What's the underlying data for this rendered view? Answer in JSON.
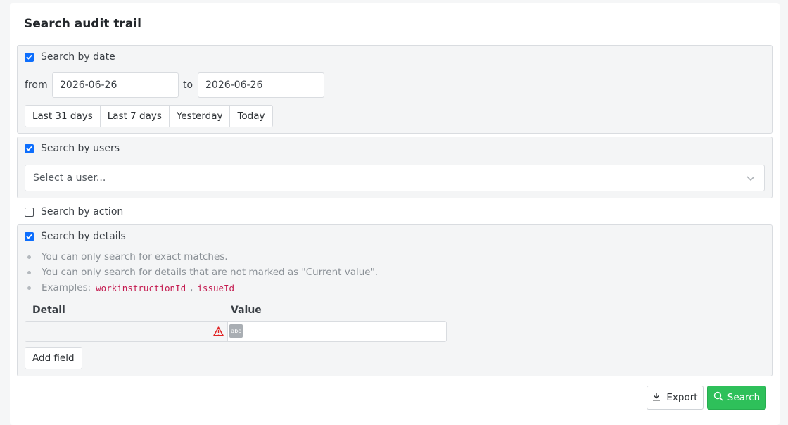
{
  "page": {
    "title": "Search audit trail"
  },
  "by_date": {
    "checked": true,
    "label": "Search by date",
    "from_label": "from",
    "from_value": "2026-06-26",
    "to_label": "to",
    "to_value": "2026-06-26",
    "ranges": [
      "Last 31 days",
      "Last 7 days",
      "Yesterday",
      "Today"
    ]
  },
  "by_users": {
    "checked": true,
    "label": "Search by users",
    "placeholder": "Select a user...",
    "icons": {
      "dropdown": "chevron-down-icon"
    }
  },
  "by_action": {
    "checked": false,
    "label": "Search by action"
  },
  "by_details": {
    "checked": true,
    "label": "Search by details",
    "notes": [
      "You can only search for exact matches.",
      "You can only search for details that are not marked as \"Current value\"."
    ],
    "examples_label": "Examples:",
    "examples": [
      "workinstructionId",
      "issueId"
    ],
    "detail_header": "Detail",
    "value_header": "Value",
    "detail_value": "",
    "value_value": "",
    "value_type_chip": "abc",
    "add_field_label": "Add field",
    "icons": {
      "warning": "warning-triangle-icon"
    },
    "colors": {
      "warning": "#e02424",
      "code": "#c41a4f"
    }
  },
  "footer": {
    "export_label": "Export",
    "search_label": "Search",
    "icons": {
      "export": "download-icon",
      "search": "search-icon"
    },
    "colors": {
      "search_bg": "#2ec05a"
    }
  },
  "colors": {
    "accent": "#0d6efd"
  }
}
